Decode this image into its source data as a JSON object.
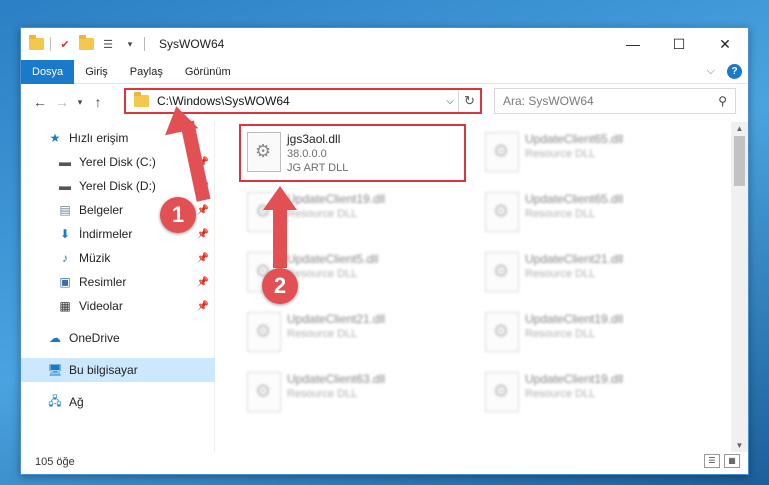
{
  "titlebar": {
    "title": "SysWOW64",
    "minimize": "—",
    "maximize": "☐",
    "close": "✕"
  },
  "ribbon": {
    "tabs": [
      {
        "label": "Dosya",
        "active": true
      },
      {
        "label": "Giriş"
      },
      {
        "label": "Paylaş"
      },
      {
        "label": "Görünüm"
      }
    ],
    "collapse": "⌵",
    "help": "?"
  },
  "address": {
    "path": "C:\\Windows\\SysWOW64",
    "search_placeholder": "Ara: SysWOW64"
  },
  "navpane": {
    "items": [
      {
        "label": "Hızlı erişim",
        "icon": "star-icon"
      },
      {
        "label": "Yerel Disk (C:)",
        "icon": "drive-icon"
      },
      {
        "label": "Yerel Disk (D:)",
        "icon": "drive-icon"
      },
      {
        "label": "Belgeler",
        "icon": "documents-icon"
      },
      {
        "label": "İndirmeler",
        "icon": "download-icon"
      },
      {
        "label": "Müzik",
        "icon": "music-icon"
      },
      {
        "label": "Resimler",
        "icon": "pictures-icon"
      },
      {
        "label": "Videolar",
        "icon": "videos-icon"
      },
      {
        "label": "OneDrive",
        "icon": "cloud-icon"
      },
      {
        "label": "Bu bilgisayar",
        "icon": "computer-icon"
      },
      {
        "label": "Ağ",
        "icon": "network-icon"
      }
    ]
  },
  "files": {
    "main": {
      "name": "jgs3aol.dll",
      "version": "38.0.0.0",
      "company": "JG ART DLL"
    },
    "blurred": [
      {
        "name": "UpdateClient65.dll",
        "desc": "Resource DLL"
      },
      {
        "name": "UpdateClient19.dll",
        "desc": "Resource DLL"
      },
      {
        "name": "UpdateClient65.dll",
        "desc": "Resource DLL"
      },
      {
        "name": "UpdateClient5.dll",
        "desc": "Resource DLL"
      },
      {
        "name": "UpdateClient21.dll",
        "desc": "Resource DLL"
      },
      {
        "name": "UpdateClient21.dll",
        "desc": "Resource DLL"
      },
      {
        "name": "UpdateClient19.dll",
        "desc": "Resource DLL"
      },
      {
        "name": "UpdateClient63.dll",
        "desc": "Resource DLL"
      },
      {
        "name": "UpdateClient19.dll",
        "desc": "Resource DLL"
      }
    ]
  },
  "status": {
    "count": "105 öğe"
  },
  "callouts": {
    "one": "1",
    "two": "2"
  },
  "colors": {
    "accent": "#1979ca",
    "callout": "#e35053",
    "selected": "#cce8ff"
  }
}
